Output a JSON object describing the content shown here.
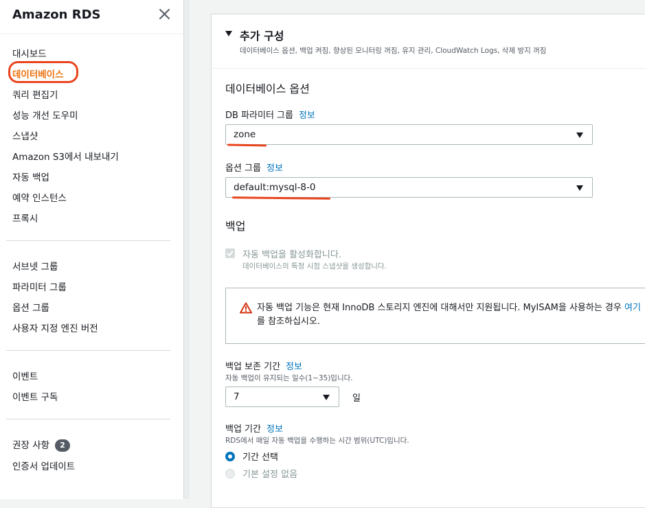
{
  "sidebar": {
    "title": "Amazon RDS",
    "close_icon": "close-icon",
    "group1": [
      {
        "label": "대시보드",
        "active": false
      },
      {
        "label": "데이터베이스",
        "active": true
      },
      {
        "label": "쿼리 편집기",
        "active": false
      },
      {
        "label": "성능 개선 도우미",
        "active": false
      },
      {
        "label": "스냅샷",
        "active": false
      },
      {
        "label": "Amazon S3에서 내보내기",
        "active": false
      },
      {
        "label": "자동 백업",
        "active": false
      },
      {
        "label": "예약 인스턴스",
        "active": false
      },
      {
        "label": "프록시",
        "active": false
      }
    ],
    "group2": [
      {
        "label": "서브넷 그룹"
      },
      {
        "label": "파라미터 그룹"
      },
      {
        "label": "옵션 그룹"
      },
      {
        "label": "사용자 지정 엔진 버전"
      }
    ],
    "group3": [
      {
        "label": "이벤트"
      },
      {
        "label": "이벤트 구독"
      }
    ],
    "group4": [
      {
        "label": "권장 사항",
        "badge": "2"
      },
      {
        "label": "인증서 업데이트"
      }
    ]
  },
  "panel": {
    "title": "추가 구성",
    "description": "데이터베이스 옵션, 백업 켜짐, 향상된 모니터링 꺼짐, 유지 관리, CloudWatch Logs, 삭제 방지 꺼짐",
    "db_options": {
      "section_title": "데이터베이스 옵션",
      "param_group_label": "DB 파라미터 그룹",
      "param_group_info": "정보",
      "param_group_value": "zone",
      "option_group_label": "옵션 그룹",
      "option_group_info": "정보",
      "option_group_value": "default:mysql-8-0"
    },
    "backup": {
      "section_title": "백업",
      "auto_backup_label": "자동 백업을 활성화합니다.",
      "auto_backup_hint": "데이터베이스의 특정 시점 스냅샷을 생성합니다.",
      "auto_backup_checked": true,
      "alert_text": "자동 백업 기능은 현재 InnoDB 스토리지 엔진에 대해서만 지원됩니다. MyISAM을 사용하는 경우 ",
      "alert_link": "여기",
      "alert_text_end": "를 참조하십시오.",
      "retention_label": "백업 보존 기간",
      "retention_info": "정보",
      "retention_hint": "자동 백업이 유지되는 일수(1~35)입니다.",
      "retention_value": "7",
      "retention_unit": "일",
      "window_label": "백업 기간",
      "window_info": "정보",
      "window_hint": "RDS에서 매일 자동 백업을 수행하는 시간 범위(UTC)입니다.",
      "window_options": [
        {
          "label": "기간 선택",
          "selected": true
        },
        {
          "label": "기본 설정 없음",
          "selected": false
        }
      ]
    }
  },
  "colors": {
    "accent_orange": "#ec7211",
    "link_blue": "#0073bb",
    "annotation_red": "#e8451e",
    "warning_red": "#d13212"
  }
}
